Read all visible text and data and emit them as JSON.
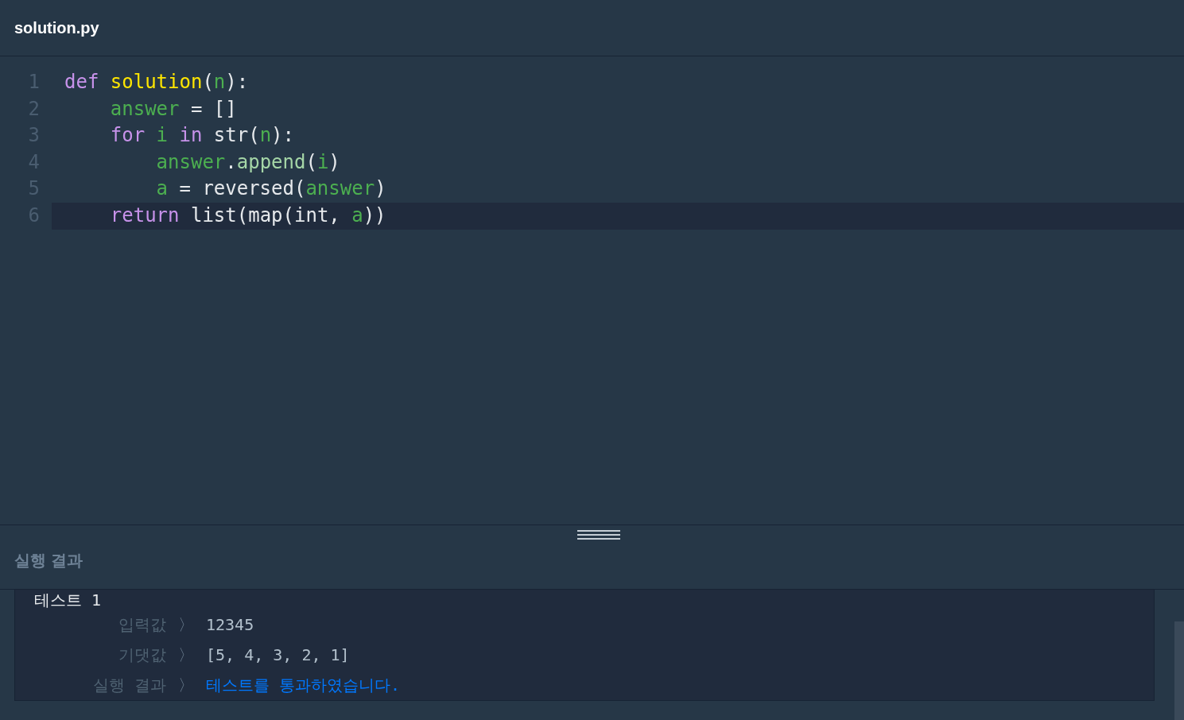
{
  "file_tab": {
    "title": "solution.py"
  },
  "editor": {
    "lines": [
      {
        "number": "1",
        "current": false,
        "tokens": [
          {
            "t": "def",
            "kind": "keyword",
            "space_after": true
          },
          {
            "t": "solution",
            "kind": "function"
          },
          {
            "t": "(",
            "kind": "plain"
          },
          {
            "t": "n",
            "kind": "variable"
          },
          {
            "t": "):",
            "kind": "plain"
          }
        ],
        "children": [
          {
            "number": "2",
            "current": false,
            "tokens": [
              {
                "t": "answer",
                "kind": "variable",
                "space_after": true
              },
              {
                "t": "=",
                "kind": "plain",
                "space_after": true
              },
              {
                "t": "[]",
                "kind": "plain"
              }
            ]
          },
          {
            "number": "3",
            "current": false,
            "tokens": [
              {
                "t": "for",
                "kind": "keyword",
                "space_after": true
              },
              {
                "t": "i",
                "kind": "variable",
                "space_after": true
              },
              {
                "t": "in",
                "kind": "keyword",
                "space_after": true
              },
              {
                "t": "str(",
                "kind": "plain"
              },
              {
                "t": "n",
                "kind": "variable"
              },
              {
                "t": "):",
                "kind": "plain"
              }
            ],
            "children": [
              {
                "number": "4",
                "current": false,
                "tokens": [
                  {
                    "t": "answer",
                    "kind": "variable"
                  },
                  {
                    "t": ".",
                    "kind": "plain"
                  },
                  {
                    "t": "append",
                    "kind": "method"
                  },
                  {
                    "t": "(",
                    "kind": "plain"
                  },
                  {
                    "t": "i",
                    "kind": "variable"
                  },
                  {
                    "t": ")",
                    "kind": "plain"
                  }
                ]
              },
              {
                "number": "5",
                "current": false,
                "tokens": [
                  {
                    "t": "a",
                    "kind": "variable",
                    "space_after": true
                  },
                  {
                    "t": "=",
                    "kind": "plain",
                    "space_after": true
                  },
                  {
                    "t": "reversed(",
                    "kind": "plain"
                  },
                  {
                    "t": "answer",
                    "kind": "variable"
                  },
                  {
                    "t": ")",
                    "kind": "plain"
                  }
                ]
              }
            ]
          },
          {
            "number": "6",
            "current": true,
            "tokens": [
              {
                "t": "return",
                "kind": "keyword",
                "space_after": true
              },
              {
                "t": "list(map(int,",
                "kind": "plain",
                "space_after": true
              },
              {
                "t": "a",
                "kind": "variable"
              },
              {
                "t": "))",
                "kind": "plain"
              }
            ]
          }
        ]
      }
    ]
  },
  "results": {
    "title": "실행 결과",
    "test": {
      "title": "테스트 1",
      "rows": [
        {
          "label": "입력값",
          "arrow": "〉",
          "value": "12345",
          "kind": "value"
        },
        {
          "label": "기댓값",
          "arrow": "〉",
          "value": "[5, 4, 3, 2, 1]",
          "kind": "value"
        },
        {
          "label": "실행 결과",
          "arrow": "〉",
          "value": "테스트를 통과하였습니다.",
          "kind": "pass"
        }
      ]
    }
  }
}
